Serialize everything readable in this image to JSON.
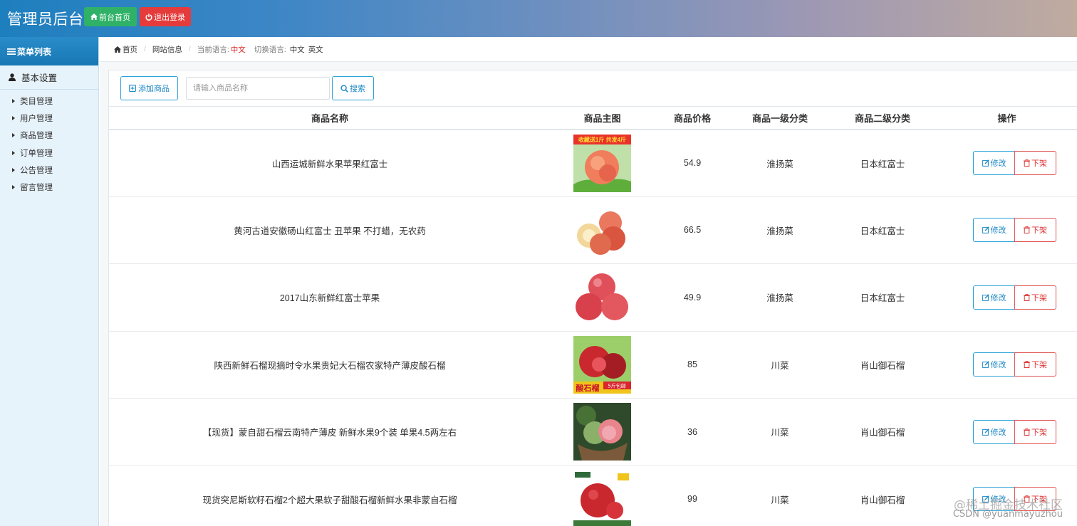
{
  "header": {
    "brand": "管理员后台",
    "home_button": "前台首页",
    "logout_button": "退出登录"
  },
  "sidebar": {
    "menu_title": "菜单列表",
    "section_title": "基本设置",
    "items": [
      {
        "label": "类目管理"
      },
      {
        "label": "用户管理"
      },
      {
        "label": "商品管理"
      },
      {
        "label": "订单管理"
      },
      {
        "label": "公告管理"
      },
      {
        "label": "留言管理"
      }
    ]
  },
  "breadcrumb": {
    "home": "首页",
    "site_info": "网站信息",
    "current_lang_label": "当前语言:",
    "current_lang": "中文",
    "switch_lang_label": "切换语言:",
    "lang_zh": "中文",
    "lang_en": "英文"
  },
  "toolbar": {
    "add_button": "添加商品",
    "search_placeholder": "请输入商品名称",
    "search_button": "搜索"
  },
  "table": {
    "columns": [
      "商品名称",
      "商品主图",
      "商品价格",
      "商品一级分类",
      "商品二级分类",
      "操作"
    ],
    "edit_label": "修改",
    "off_label": "下架",
    "rows": [
      {
        "name": "山西运城新鲜水果苹果红富士",
        "image": "peach-apple-photo",
        "price": "54.9",
        "cat1": "淮扬菜",
        "cat2": "日本红富士"
      },
      {
        "name": "黄河古道安徽砀山红富士 丑苹果 不打蜡，无农药",
        "image": "apples-cut-photo",
        "price": "66.5",
        "cat1": "淮扬菜",
        "cat2": "日本红富士"
      },
      {
        "name": "2017山东新鲜红富士苹果",
        "image": "red-apples-photo",
        "price": "49.9",
        "cat1": "淮扬菜",
        "cat2": "日本红富士"
      },
      {
        "name": "陕西新鲜石榴现摘时令水果贵妃大石榴农家特产薄皮酸石榴",
        "image": "sour-pomegranate-photo",
        "price": "85",
        "cat1": "川菜",
        "cat2": "肖山御石榴"
      },
      {
        "name": "【现货】蒙自甜石榴云南特产薄皮 新鲜水果9个装 单果4.5两左右",
        "image": "pomegranate-basket-photo",
        "price": "36",
        "cat1": "川菜",
        "cat2": "肖山御石榴"
      },
      {
        "name": "现货突尼斯软籽石榴2个超大果软子甜酸石榴新鲜水果非蒙自石榴",
        "image": "tunisia-pomegranate-photo",
        "price": "99",
        "cat1": "川菜",
        "cat2": "肖山御石榴"
      }
    ]
  },
  "image_text": {
    "row1_banner": "收藏送1斤 共发4斤",
    "row4_label": "酸石榴",
    "row4_badge": "5斤包邮"
  },
  "watermark": {
    "line1": "@稀土掘金技术社区",
    "line2": "CSDN @yuanmayuzhou"
  }
}
